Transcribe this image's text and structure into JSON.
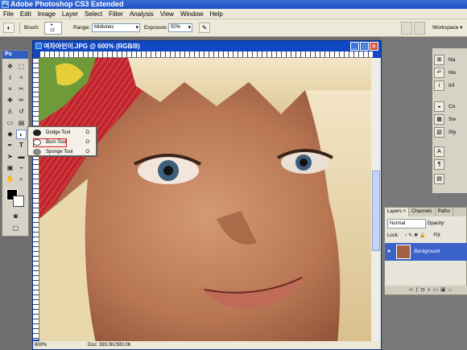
{
  "app": {
    "title": "Adobe Photoshop CS3 Extended",
    "icon_text": "Ps"
  },
  "menu": [
    "File",
    "Edit",
    "Image",
    "Layer",
    "Select",
    "Filter",
    "Analysis",
    "View",
    "Window",
    "Help"
  ],
  "options_bar": {
    "brush_label": "Brush:",
    "brush_size": "13",
    "range_label": "Range:",
    "range_value": "Midtones",
    "exposure_label": "Exposure:",
    "exposure_value": "50%",
    "workspace_label": "Workspace ▾"
  },
  "toolbox": {
    "header": "Ps"
  },
  "document": {
    "title": "여자아인이.JPG @ 600% (RGB/8)",
    "zoom": "600%",
    "doc_info": "Doc: 393.0K/393.0K"
  },
  "flyout": {
    "items": [
      {
        "label": "Dodge Tool",
        "key": "O",
        "icon": "dodge-icon"
      },
      {
        "label": "Burn Tool",
        "key": "O",
        "icon": "burn-icon"
      },
      {
        "label": "Sponge Tool",
        "key": "O",
        "icon": "sponge-icon"
      }
    ],
    "selected_index": 1
  },
  "right_panels": [
    {
      "label": "Na",
      "icon": "navigator-icon"
    },
    {
      "label": "His",
      "icon": "history-icon"
    },
    {
      "label": "Inf",
      "icon": "info-icon"
    },
    {
      "label": "Co",
      "icon": "color-icon"
    },
    {
      "label": "Sw",
      "icon": "swatches-icon"
    },
    {
      "label": "Sty",
      "icon": "styles-icon"
    }
  ],
  "layers_panel": {
    "tabs": [
      "Layers ×",
      "Channels",
      "Paths"
    ],
    "blend_mode": "Normal",
    "opacity_label": "Opacity:",
    "lock_label": "Lock:",
    "fill_label": "Fill:",
    "layer_name": "Background"
  },
  "colors": {
    "title_blue": "#1f4fc4",
    "doc_frame": "#1048c4",
    "highlight_red": "#e0141e",
    "panel_bg": "#ece9d8"
  }
}
